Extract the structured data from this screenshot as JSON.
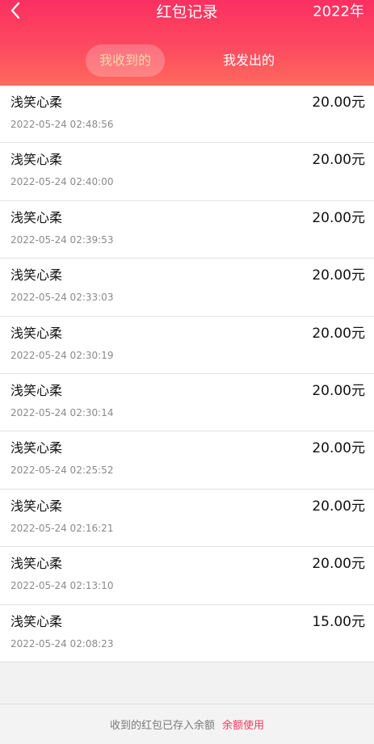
{
  "header": {
    "title": "红包记录",
    "year": "2022年",
    "back_icon": "chevron-left-icon",
    "tabs": [
      {
        "label": "我收到的",
        "active": true
      },
      {
        "label": "我发出的",
        "active": false
      }
    ],
    "colors": {
      "gradient_top": "#fb2f62",
      "gradient_bottom": "#fe6a5e",
      "active_tab_text": "#ffd6a8"
    }
  },
  "records": [
    {
      "name": "浅笑心柔",
      "time": "2022-05-24 02:48:56",
      "amount": "20.00元"
    },
    {
      "name": "浅笑心柔",
      "time": "2022-05-24 02:40:00",
      "amount": "20.00元"
    },
    {
      "name": "浅笑心柔",
      "time": "2022-05-24 02:39:53",
      "amount": "20.00元"
    },
    {
      "name": "浅笑心柔",
      "time": "2022-05-24 02:33:03",
      "amount": "20.00元"
    },
    {
      "name": "浅笑心柔",
      "time": "2022-05-24 02:30:19",
      "amount": "20.00元"
    },
    {
      "name": "浅笑心柔",
      "time": "2022-05-24 02:30:14",
      "amount": "20.00元"
    },
    {
      "name": "浅笑心柔",
      "time": "2022-05-24 02:25:52",
      "amount": "20.00元"
    },
    {
      "name": "浅笑心柔",
      "time": "2022-05-24 02:16:21",
      "amount": "20.00元"
    },
    {
      "name": "浅笑心柔",
      "time": "2022-05-24 02:13:10",
      "amount": "20.00元"
    },
    {
      "name": "浅笑心柔",
      "time": "2022-05-24 02:08:23",
      "amount": "15.00元"
    }
  ],
  "footer": {
    "note": "收到的红包已存入余额",
    "link": "余额使用",
    "link_color": "#f03a5f"
  }
}
